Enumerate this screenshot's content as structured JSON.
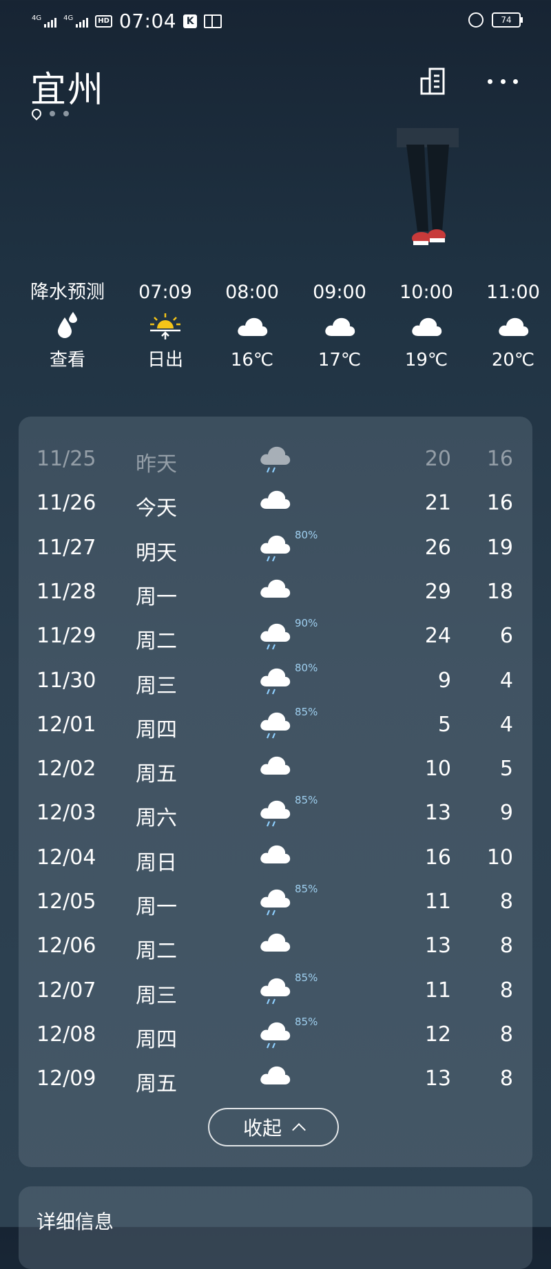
{
  "status_bar": {
    "signal1": "4G",
    "signal2": "4G",
    "hd": "HD",
    "time": "07:04",
    "k_icon": "K",
    "battery": "74"
  },
  "header": {
    "city": "宜州"
  },
  "hourly": [
    {
      "top": "降水预测",
      "icon": "raindrop-icon",
      "bottom": "查看"
    },
    {
      "top": "07:09",
      "icon": "sunrise-icon",
      "bottom": "日出"
    },
    {
      "top": "08:00",
      "icon": "cloud-icon",
      "bottom": "16℃"
    },
    {
      "top": "09:00",
      "icon": "cloud-icon",
      "bottom": "17℃"
    },
    {
      "top": "10:00",
      "icon": "cloud-icon",
      "bottom": "19℃"
    },
    {
      "top": "11:00",
      "icon": "cloud-icon",
      "bottom": "20℃"
    }
  ],
  "forecast": [
    {
      "date": "11/25",
      "day": "昨天",
      "icon": "rain-icon",
      "pct": "",
      "hi": "20",
      "lo": "16",
      "past": true
    },
    {
      "date": "11/26",
      "day": "今天",
      "icon": "cloud-icon",
      "pct": "",
      "hi": "21",
      "lo": "16",
      "past": false
    },
    {
      "date": "11/27",
      "day": "明天",
      "icon": "rain-icon",
      "pct": "80%",
      "hi": "26",
      "lo": "19",
      "past": false
    },
    {
      "date": "11/28",
      "day": "周一",
      "icon": "cloud-icon",
      "pct": "",
      "hi": "29",
      "lo": "18",
      "past": false
    },
    {
      "date": "11/29",
      "day": "周二",
      "icon": "rain-icon",
      "pct": "90%",
      "hi": "24",
      "lo": "6",
      "past": false
    },
    {
      "date": "11/30",
      "day": "周三",
      "icon": "rain-icon",
      "pct": "80%",
      "hi": "9",
      "lo": "4",
      "past": false
    },
    {
      "date": "12/01",
      "day": "周四",
      "icon": "rain-icon",
      "pct": "85%",
      "hi": "5",
      "lo": "4",
      "past": false
    },
    {
      "date": "12/02",
      "day": "周五",
      "icon": "cloud-icon",
      "pct": "",
      "hi": "10",
      "lo": "5",
      "past": false
    },
    {
      "date": "12/03",
      "day": "周六",
      "icon": "rain-icon",
      "pct": "85%",
      "hi": "13",
      "lo": "9",
      "past": false
    },
    {
      "date": "12/04",
      "day": "周日",
      "icon": "cloud-icon",
      "pct": "",
      "hi": "16",
      "lo": "10",
      "past": false
    },
    {
      "date": "12/05",
      "day": "周一",
      "icon": "rain-icon",
      "pct": "85%",
      "hi": "11",
      "lo": "8",
      "past": false
    },
    {
      "date": "12/06",
      "day": "周二",
      "icon": "cloud-icon",
      "pct": "",
      "hi": "13",
      "lo": "8",
      "past": false
    },
    {
      "date": "12/07",
      "day": "周三",
      "icon": "rain-icon",
      "pct": "85%",
      "hi": "11",
      "lo": "8",
      "past": false
    },
    {
      "date": "12/08",
      "day": "周四",
      "icon": "rain-icon",
      "pct": "85%",
      "hi": "12",
      "lo": "8",
      "past": false
    },
    {
      "date": "12/09",
      "day": "周五",
      "icon": "cloud-icon",
      "pct": "",
      "hi": "13",
      "lo": "8",
      "past": false
    }
  ],
  "collapse_label": "收起",
  "details_title": "详细信息",
  "colors": {
    "background_top": "#172433",
    "background_bottom": "#2e4252",
    "precip_text": "#9fd0f0",
    "sun": "#f5c518"
  }
}
